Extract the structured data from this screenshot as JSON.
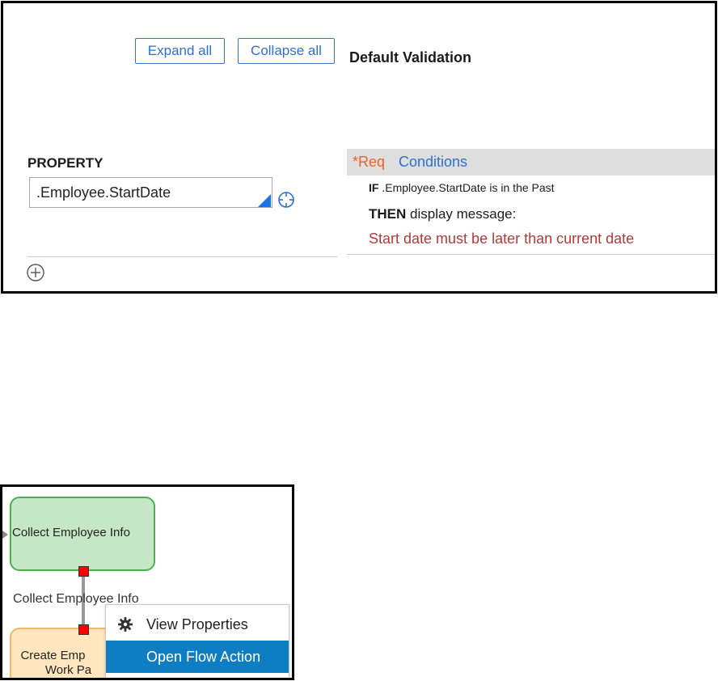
{
  "validation_panel": {
    "expand_all_label": "Expand all",
    "collapse_all_label": "Collapse all",
    "heading": "Default Validation",
    "property_label": "PROPERTY",
    "property_value": ".Employee.StartDate",
    "condition_header": {
      "req_label": "*Req",
      "conditions_label": "Conditions"
    },
    "condition": {
      "if_keyword": "IF",
      "if_text": " .Employee.StartDate is in the Past",
      "then_keyword": "THEN",
      "then_text": " display message:",
      "message": "Start date must be later than current date"
    },
    "colors": {
      "link_blue": "#2f6fcd",
      "req_orange": "#e8632b",
      "message_red": "#b33a3a"
    }
  },
  "flow_panel": {
    "green_shape_label": "Collect Employee Info",
    "connector_label": "Collect Employee Info",
    "orange_shape_label_line1": "Create Emp",
    "orange_shape_label_line2": "Work Pa",
    "context_menu": {
      "items": [
        {
          "label": "View Properties",
          "icon": "gear-icon"
        },
        {
          "label": "Open Flow Action",
          "selected": true
        }
      ]
    },
    "colors": {
      "green_fill": "#c6e7c6",
      "orange_fill": "#ffe6bf",
      "menu_selected": "#0f7dc2",
      "handle_red": "#ff0000"
    }
  }
}
